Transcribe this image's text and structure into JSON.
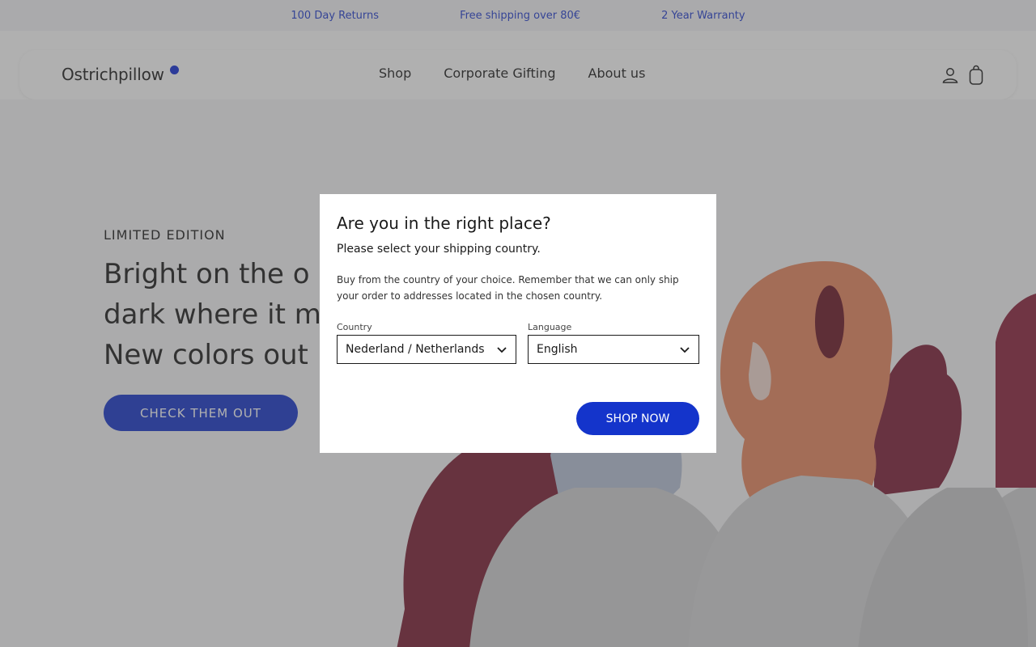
{
  "topbar": {
    "items": [
      "100 Day Returns",
      "Free shipping over 80€",
      "2 Year Warranty"
    ]
  },
  "header": {
    "logo": "Ostrichpillow",
    "nav": [
      "Shop",
      "Corporate Gifting",
      "About us"
    ],
    "icons": [
      "account-icon",
      "cart-icon"
    ]
  },
  "hero": {
    "eyebrow": "LIMITED EDITION",
    "headline_lines": [
      "Bright on the o",
      "dark where it m",
      "New colors out"
    ],
    "cta_label": "CHECK THEM OUT"
  },
  "modal": {
    "title": "Are you in the right place?",
    "subtitle": "Please select your shipping country.",
    "body": "Buy from the country of your choice. Remember that we can only ship your order to addresses located in the chosen country.",
    "country_label": "Country",
    "country_value": "Nederland / Netherlands",
    "language_label": "Language",
    "language_value": "English",
    "button": "SHOP NOW"
  },
  "colors": {
    "accent": "#1434cb",
    "brand_dot": "#0f2ad6",
    "topbar_text": "#1f3bcf"
  }
}
